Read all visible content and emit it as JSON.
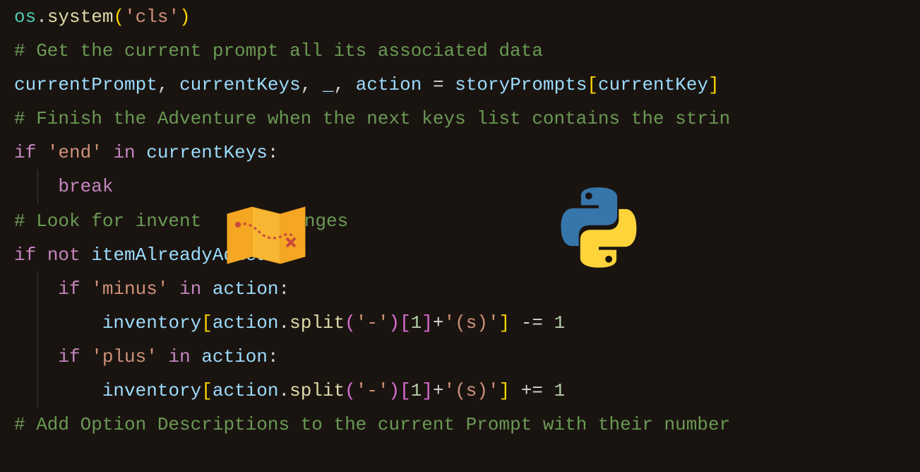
{
  "code": {
    "l0": {
      "obj": "os",
      "dot": ".",
      "func": "system",
      "lp": "(",
      "str": "'cls'",
      "rp": ")"
    },
    "l1": {
      "comment": "# Get the current prompt all its associated data"
    },
    "l2": {
      "v1": "currentPrompt",
      "c1": ", ",
      "v2": "currentKeys",
      "c2": ", ",
      "v3": "_",
      "c3": ", ",
      "v4": "action",
      "eq": " = ",
      "v5": "storyPrompts",
      "lb": "[",
      "v6": "currentKey",
      "rb": "]"
    },
    "l3": {
      "comment": "# Finish the Adventure when the next keys list contains the strin"
    },
    "l4": {
      "kw1": "if",
      "sp1": " ",
      "str": "'end'",
      "sp2": " ",
      "kw2": "in",
      "sp3": " ",
      "var": "currentKeys",
      "colon": ":"
    },
    "l5": {
      "indent": "    ",
      "kw": "break"
    },
    "l6": {
      "comment_a": "# Look for invent",
      "comment_b": "anges"
    },
    "l7": {
      "kw1": "if",
      "sp1": " ",
      "kw2": "not",
      "sp2": " ",
      "var": "itemAlreadyAdded",
      "colon": ":"
    },
    "l8": {
      "indent": "    ",
      "kw1": "if",
      "sp1": " ",
      "str": "'minus'",
      "sp2": " ",
      "kw2": "in",
      "sp3": " ",
      "var": "action",
      "colon": ":"
    },
    "l9": {
      "indent": "        ",
      "v1": "inventory",
      "lb1": "[",
      "v2": "action",
      "dot": ".",
      "func": "split",
      "lp": "(",
      "str1": "'-'",
      "rp": ")",
      "lb2": "[",
      "num": "1",
      "rb2": "]",
      "plus": "+",
      "str2": "'(s)'",
      "rb1": "]",
      "op": " -= ",
      "num2": "1"
    },
    "l10": {
      "indent": "    ",
      "kw1": "if",
      "sp1": " ",
      "str": "'plus'",
      "sp2": " ",
      "kw2": "in",
      "sp3": " ",
      "var": "action",
      "colon": ":"
    },
    "l11": {
      "indent": "        ",
      "v1": "inventory",
      "lb1": "[",
      "v2": "action",
      "dot": ".",
      "func": "split",
      "lp": "(",
      "str1": "'-'",
      "rp": ")",
      "lb2": "[",
      "num": "1",
      "rb2": "]",
      "plus": "+",
      "str2": "'(s)'",
      "rb1": "]",
      "op": " += ",
      "num2": "1"
    },
    "l12": {
      "comment": "# Add Option Descriptions to the current Prompt with their number"
    }
  },
  "icons": {
    "map": "treasure-map-icon",
    "python": "python-logo-icon"
  }
}
